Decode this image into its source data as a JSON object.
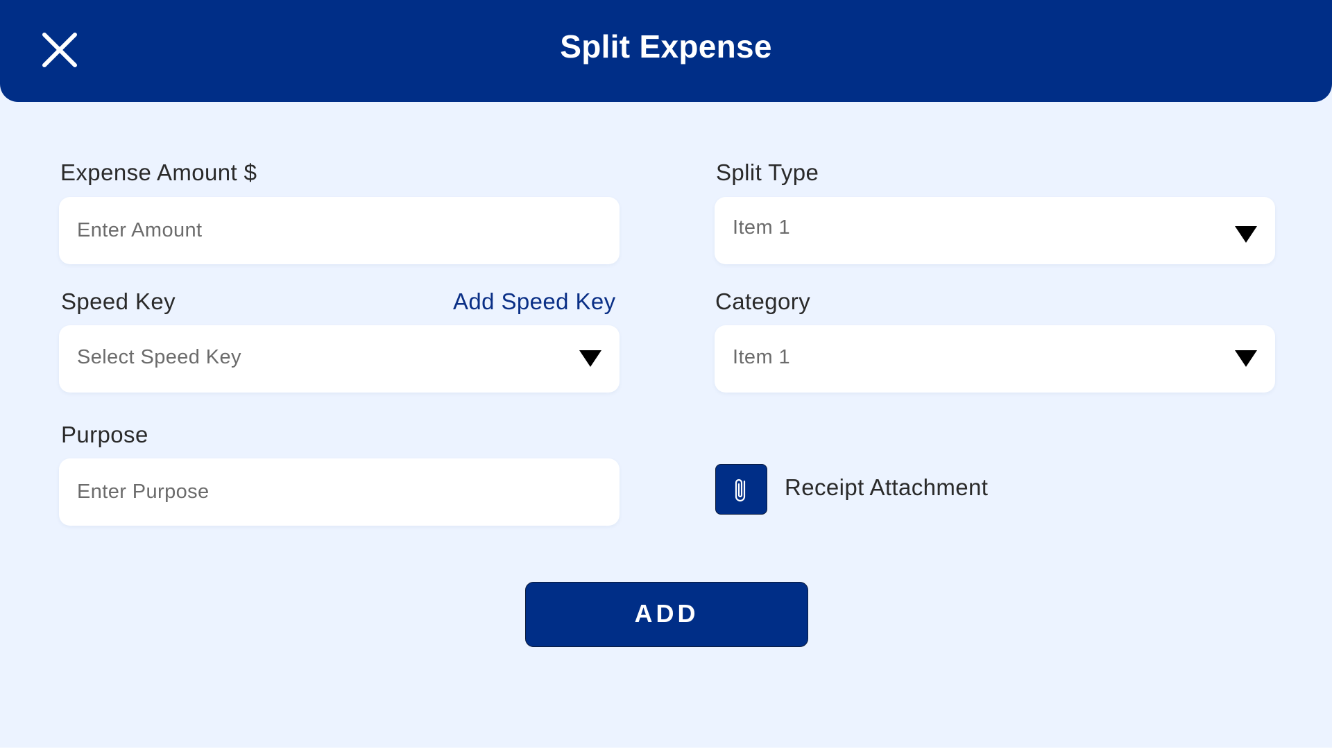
{
  "header": {
    "title": "Split Expense"
  },
  "form": {
    "expense_amount": {
      "label": "Expense Amount $",
      "placeholder": "Enter Amount",
      "value": ""
    },
    "split_type": {
      "label": "Split Type",
      "selected": "Item 1"
    },
    "speed_key": {
      "label": "Speed Key",
      "add_link": "Add Speed Key",
      "placeholder": "Select Speed Key"
    },
    "category": {
      "label": "Category",
      "selected": "Item 1"
    },
    "purpose": {
      "label": "Purpose",
      "placeholder": "Enter Purpose",
      "value": ""
    },
    "receipt": {
      "label": "Receipt Attachment"
    },
    "submit_label": "ADD"
  },
  "icons": {
    "close": "close-icon",
    "dropdown": "triangle-down-icon",
    "attachment": "paperclip-icon"
  },
  "colors": {
    "primary": "#002e87",
    "background": "#ecf3ff",
    "link": "#0a2f86"
  }
}
